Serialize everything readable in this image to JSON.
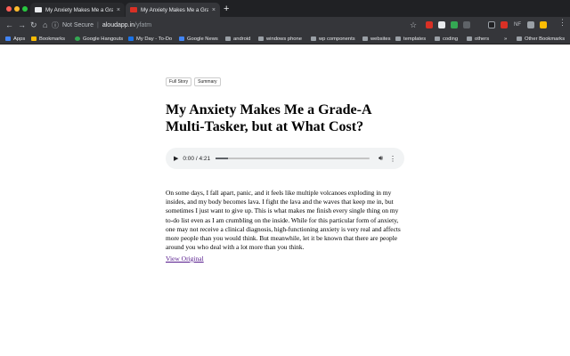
{
  "browser": {
    "tabs": [
      {
        "title": "My Anxiety Makes Me a Grade-A",
        "active": false
      },
      {
        "title": "My Anxiety Makes Me a Grade-A",
        "active": true
      }
    ],
    "new_tab": "+",
    "close_glyph": "×",
    "url": {
      "security_label": "Not Secure",
      "host": "aloudapp.in",
      "path": "/yfatm"
    },
    "extensions": [
      "NF"
    ],
    "bookmarks": [
      {
        "label": "Apps",
        "icon": "apps-grid-icon"
      },
      {
        "label": "Bookmarks",
        "icon": "star-icon"
      },
      {
        "label": "Google Hangouts",
        "icon": "hangouts-icon"
      },
      {
        "label": "My Day - To-Do",
        "icon": "todo-icon"
      },
      {
        "label": "Google News",
        "icon": "news-icon"
      },
      {
        "label": "android",
        "icon": "folder-icon"
      },
      {
        "label": "windows phone",
        "icon": "folder-icon"
      },
      {
        "label": "wp components",
        "icon": "folder-icon"
      },
      {
        "label": "websites",
        "icon": "folder-icon"
      },
      {
        "label": "templates",
        "icon": "folder-icon"
      },
      {
        "label": "coding",
        "icon": "folder-icon"
      },
      {
        "label": "others",
        "icon": "folder-icon"
      }
    ],
    "bookmarks_overflow": "»",
    "other_bookmarks": "Other Bookmarks"
  },
  "article": {
    "tabs": [
      "Full Story",
      "Summary"
    ],
    "title": "My Anxiety Makes Me a Grade-A Multi-Tasker, but at What Cost?",
    "audio": {
      "time": "0:00 / 4:21",
      "progress": 0.0
    },
    "body": "On some days, I fall apart, panic, and it feels like multiple volcanoes exploding in my insides, and my body becomes lava. I fight the lava and the waves that keep me in, but sometimes I just want to give up. This is what makes me finish every single thing on my to-do list even as I am crumbling on the inside. While for this particular form of anxiety, one may not receive a clinical diagnosis, high-functioning anxiety is very real and affects more people than you would think. But meanwhile, let it be known that there are people around you who deal with a lot more than you think.",
    "link": "View Original"
  },
  "colors": {
    "tabstrip": "#202124",
    "toolbar": "#35363a",
    "link": "#551a8b",
    "player": "#f1f3f4"
  }
}
